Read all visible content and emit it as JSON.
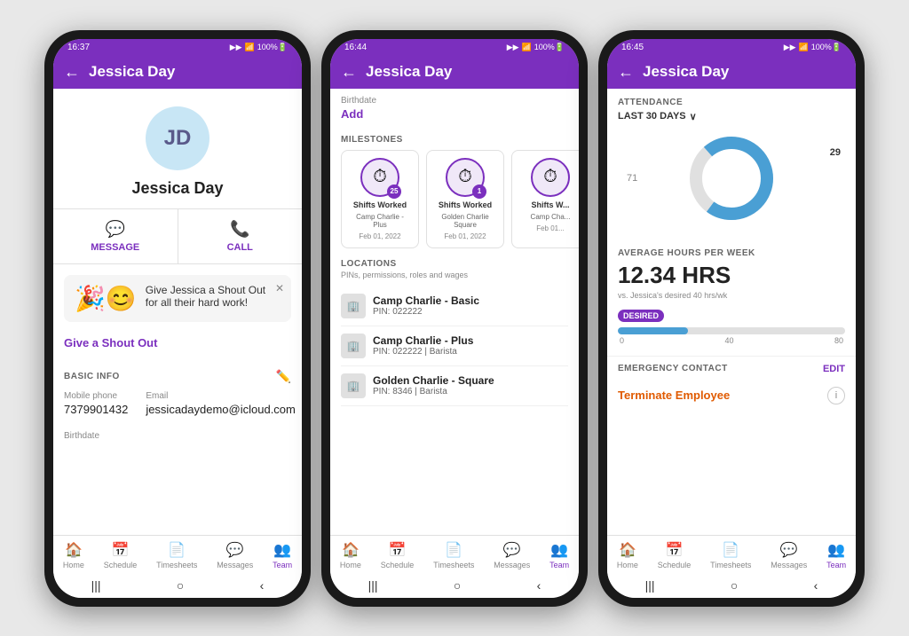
{
  "screen1": {
    "status_time": "16:37",
    "title": "Jessica Day",
    "avatar_initials": "JD",
    "user_name": "Jessica Day",
    "message_label": "MESSAGE",
    "call_label": "CALL",
    "shoutout_text": "Give Jessica a Shout Out for all their hard work!",
    "shoutout_link": "Give a Shout Out",
    "basic_info_label": "BASIC INFO",
    "mobile_label": "Mobile phone",
    "mobile_value": "7379901432",
    "email_label": "Email",
    "email_value": "jessicadaydemo@icloud.com",
    "birthdate_label": "Birthdate"
  },
  "screen2": {
    "status_time": "16:44",
    "title": "Jessica Day",
    "birthdate_label": "Birthdate",
    "add_label": "Add",
    "milestones_label": "MILESTONES",
    "milestones": [
      {
        "badge": "25",
        "title": "Shifts Worked",
        "location": "Camp Charlie - Plus",
        "date": "Feb 01, 2022"
      },
      {
        "badge": "1",
        "title": "Shifts Worked",
        "location": "Golden Charlie Square",
        "date": "Feb 01, 2022"
      },
      {
        "badge": "",
        "title": "Shifts W...",
        "location": "Camp Cha...",
        "date": "Feb 01..."
      }
    ],
    "locations_label": "LOCATIONS",
    "locations_subtitle": "PINs, permissions, roles and wages",
    "locations": [
      {
        "name": "Camp Charlie - Basic",
        "pin": "PIN: 022222"
      },
      {
        "name": "Camp Charlie - Plus",
        "pin": "PIN: 022222 | Barista"
      },
      {
        "name": "Golden Charlie - Square",
        "pin": "PIN: 8346 | Barista"
      }
    ]
  },
  "screen3": {
    "status_time": "16:45",
    "title": "Jessica Day",
    "attendance_label": "ATTENDANCE",
    "period_label": "LAST 30 DAYS",
    "donut_value": "29",
    "donut_other": "71",
    "avg_hours_label": "AVERAGE HOURS PER WEEK",
    "avg_hours_value": "12.34 HRS",
    "avg_hours_sub": "vs. Jessica's desired 40 hrs/wk",
    "desired_badge": "DESIRED",
    "progress_fill_pct": "31",
    "progress_labels": [
      "0",
      "40",
      "80"
    ],
    "emergency_label": "EMERGENCY CONTACT",
    "emergency_edit": "EDIT",
    "terminate_label": "Terminate Employee"
  },
  "bottom_nav": {
    "items": [
      {
        "icon": "🏠",
        "label": "Home"
      },
      {
        "icon": "📅",
        "label": "Schedule"
      },
      {
        "icon": "📄",
        "label": "Timesheets"
      },
      {
        "icon": "💬",
        "label": "Messages"
      },
      {
        "icon": "👥",
        "label": "Team"
      }
    ]
  }
}
